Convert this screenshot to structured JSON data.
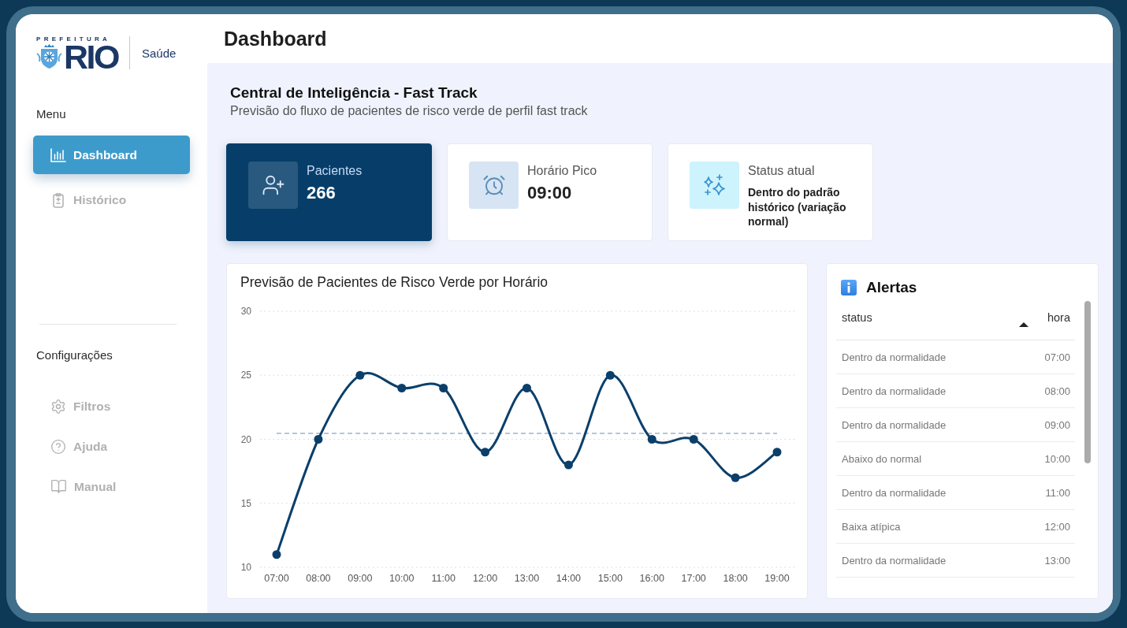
{
  "sidebar": {
    "logo": {
      "caption": "PREFEITURA",
      "wordmark": "RIO",
      "unit": "Saúde"
    },
    "sections": [
      {
        "title": "Menu",
        "items": [
          {
            "label": "Dashboard",
            "selected": true
          },
          {
            "label": "Histórico",
            "selected": false
          }
        ]
      },
      {
        "title": "Configurações",
        "items": [
          {
            "label": "Filtros",
            "selected": false
          },
          {
            "label": "Ajuda",
            "selected": false
          },
          {
            "label": "Manual",
            "selected": false
          }
        ]
      }
    ]
  },
  "header": {
    "title": "Dashboard"
  },
  "intro": {
    "title": "Central de Inteligência - Fast Track",
    "subtitle": "Previsão do fluxo de pacientes de risco verde de perfil fast track"
  },
  "stat_cards": [
    {
      "kind": "metric",
      "highlighted": true,
      "label": "Pacientes",
      "value": "266"
    },
    {
      "kind": "metric",
      "highlighted": false,
      "label": "Horário Pico",
      "value": "09:00"
    },
    {
      "kind": "status",
      "highlighted": false,
      "label": "Status atual",
      "value": "Dentro do padrão histórico (variação normal)"
    }
  ],
  "forecast_chart": {
    "chart_data": {
      "type": "line",
      "title": "Previsão de Pacientes de Risco Verde por Horário",
      "categories": [
        "07:00",
        "08:00",
        "09:00",
        "10:00",
        "11:00",
        "12:00",
        "13:00",
        "14:00",
        "15:00",
        "16:00",
        "17:00",
        "18:00",
        "19:00"
      ],
      "series": [
        {
          "color": "#0b3f6b",
          "marker": "circle",
          "values": [
            11,
            20,
            25,
            24,
            24,
            19,
            24,
            18,
            25,
            20,
            20,
            17,
            19
          ]
        },
        {
          "color": "#9db5cc",
          "line_style": "dashed",
          "values": [
            20.46,
            20.46,
            20.46,
            20.46,
            20.46,
            20.46,
            20.46,
            20.46,
            20.46,
            20.46,
            20.46,
            20.46,
            20.46
          ]
        }
      ],
      "ylim": [
        10,
        30
      ],
      "yticks": [
        10,
        15,
        20,
        25,
        30
      ],
      "grid": true
    }
  },
  "alerts": {
    "title": "Alertas",
    "columns": [
      {
        "label": "status",
        "sorted": false
      },
      {
        "label": "hora",
        "sorted": true
      }
    ],
    "rows": [
      {
        "status": "Dentro da normalidade",
        "hora": "07:00"
      },
      {
        "status": "Dentro da normalidade",
        "hora": "08:00"
      },
      {
        "status": "Dentro da normalidade",
        "hora": "09:00"
      },
      {
        "status": "Abaixo do normal",
        "hora": "10:00"
      },
      {
        "status": "Dentro da normalidade",
        "hora": "11:00"
      },
      {
        "status": "Baixa atípica",
        "hora": "12:00"
      },
      {
        "status": "Dentro da normalidade",
        "hora": "13:00"
      }
    ]
  }
}
